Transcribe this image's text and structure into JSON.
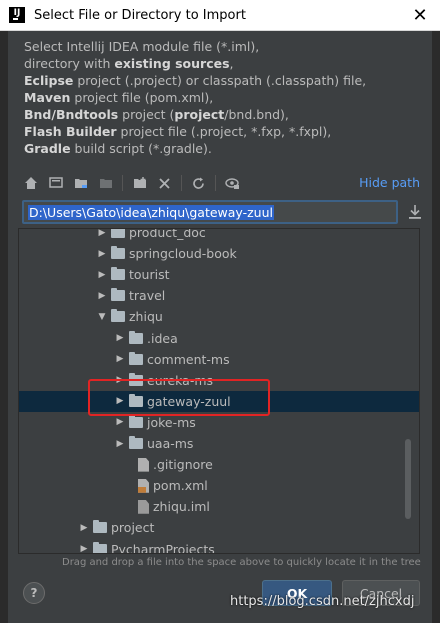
{
  "window": {
    "title": "Select File or Directory to Import",
    "close_glyph": "✕"
  },
  "description": {
    "line1": "Select Intellij IDEA module file (*.iml),",
    "line2_pre": "directory with ",
    "line2_bold": "existing sources",
    "line2_post": ",",
    "line3_bold": "Eclipse",
    "line3_post": " project (.project) or classpath (.classpath) file,",
    "line4_bold": "Maven",
    "line4_post": " project file (pom.xml),",
    "line5_bold": "Bnd/Bndtools",
    "line5_mid": " project (",
    "line5_bold2": "project",
    "line5_post": "/bnd.bnd),",
    "line6_bold": "Flash Builder",
    "line6_post": " project file (.project, *.fxp, *.fxpl),",
    "line7_bold": "Gradle",
    "line7_post": " build script (*.gradle)."
  },
  "toolbar": {
    "hide_path_label": "Hide path"
  },
  "path": {
    "value": "D:\\Users\\Gato\\idea\\zhiqu\\gateway-zuul"
  },
  "tree": {
    "items": [
      {
        "label": "product_doc",
        "type": "folder",
        "depth": 2,
        "expanded": false
      },
      {
        "label": "springcloud-book",
        "type": "folder",
        "depth": 2,
        "expanded": false
      },
      {
        "label": "tourist",
        "type": "folder",
        "depth": 2,
        "expanded": false
      },
      {
        "label": "travel",
        "type": "folder",
        "depth": 2,
        "expanded": false
      },
      {
        "label": "zhiqu",
        "type": "folder",
        "depth": 2,
        "expanded": true
      },
      {
        "label": ".idea",
        "type": "folder",
        "depth": 3,
        "expanded": false
      },
      {
        "label": "comment-ms",
        "type": "folder",
        "depth": 3,
        "expanded": false
      },
      {
        "label": "eureka-ms",
        "type": "folder",
        "depth": 3,
        "expanded": false
      },
      {
        "label": "gateway-zuul",
        "type": "folder",
        "depth": 3,
        "expanded": false,
        "selected": true
      },
      {
        "label": "joke-ms",
        "type": "folder",
        "depth": 3,
        "expanded": false
      },
      {
        "label": "uaa-ms",
        "type": "folder",
        "depth": 3,
        "expanded": false
      },
      {
        "label": ".gitignore",
        "type": "file",
        "depth": 4
      },
      {
        "label": "pom.xml",
        "type": "xml",
        "depth": 4
      },
      {
        "label": "zhiqu.iml",
        "type": "iml",
        "depth": 4
      },
      {
        "label": "project",
        "type": "folder",
        "depth": 1,
        "expanded": false
      },
      {
        "label": "PycharmProjects",
        "type": "folder",
        "depth": 1,
        "expanded": false
      }
    ]
  },
  "hint": "Drag and drop a file into the space above to quickly locate it in the tree",
  "buttons": {
    "help": "?",
    "ok": "OK",
    "cancel": "Cancel"
  },
  "watermark": "https://blog.csdn.net/zjhcxdj",
  "colors": {
    "background": "#3c3f41",
    "link": "#589df6",
    "selection": "#0d293e",
    "highlight_box": "#e22424",
    "ok_button": "#365880"
  }
}
